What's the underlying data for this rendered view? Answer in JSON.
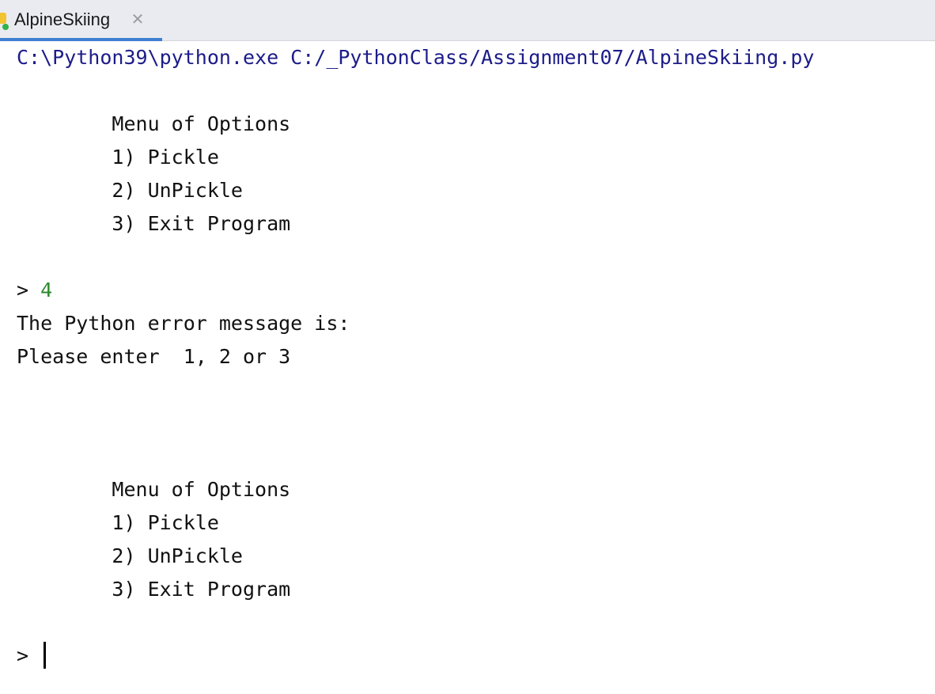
{
  "tab": {
    "title": "AlpineSkiing",
    "close_glyph": "✕"
  },
  "console": {
    "command": "C:\\Python39\\python.exe C:/_PythonClass/Assignment07/AlpineSkiing.py",
    "menu1": {
      "title": "        Menu of Options",
      "opt1": "        1) Pickle",
      "opt2": "        2) UnPickle",
      "opt3": "        3) Exit Program"
    },
    "prompt1": "> ",
    "input1": "4",
    "error_header": "The Python error message is:",
    "error_text": "Please enter  1, 2 or 3",
    "menu2": {
      "title": "        Menu of Options",
      "opt1": "        1) Pickle",
      "opt2": "        2) UnPickle",
      "opt3": "        3) Exit Program"
    },
    "prompt2": "> "
  },
  "colors": {
    "command": "#1c1c8a",
    "user_input": "#2c8a2c",
    "tab_accent": "#3f7fd1"
  }
}
